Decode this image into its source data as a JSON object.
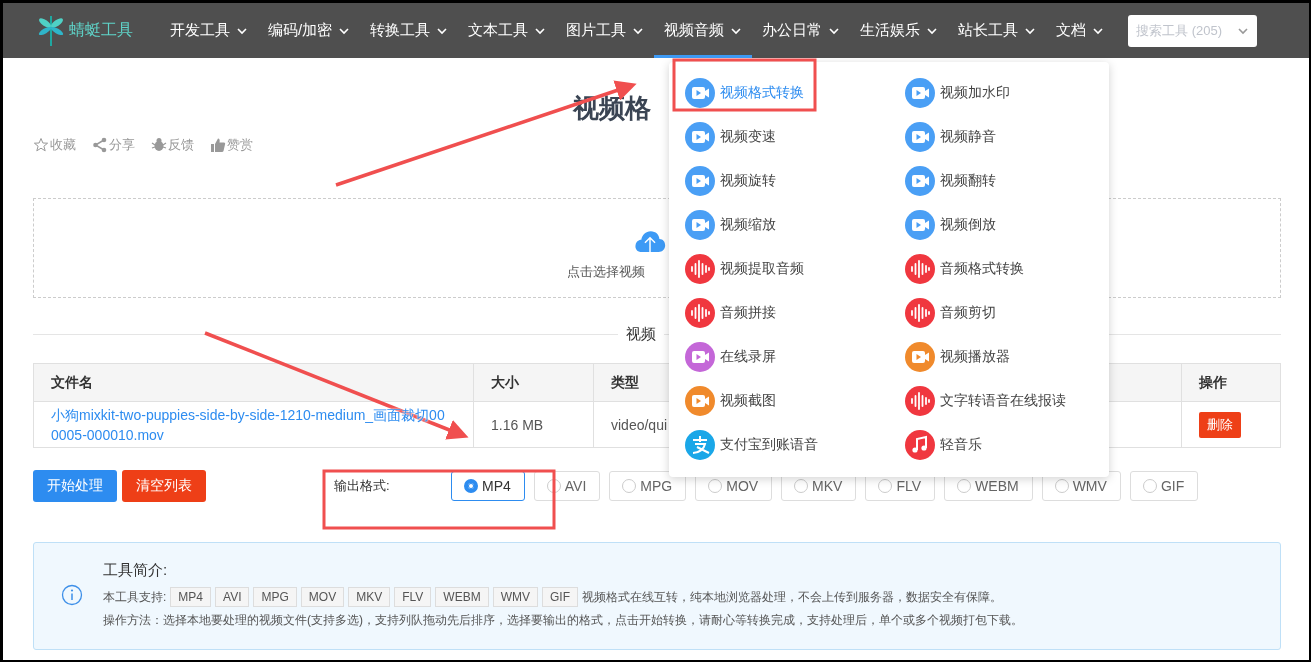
{
  "nav": {
    "logo": "蜻蜓工具",
    "items": [
      {
        "label": "开发工具",
        "selected": false
      },
      {
        "label": "编码/加密",
        "selected": false
      },
      {
        "label": "转换工具",
        "selected": false
      },
      {
        "label": "文本工具",
        "selected": false
      },
      {
        "label": "图片工具",
        "selected": false
      },
      {
        "label": "视频音频",
        "selected": true
      },
      {
        "label": "办公日常",
        "selected": false
      },
      {
        "label": "生活娱乐",
        "selected": false
      },
      {
        "label": "站长工具",
        "selected": false
      },
      {
        "label": "文档",
        "selected": false
      }
    ],
    "search": {
      "placeholder": "搜索工具 (205)"
    }
  },
  "dropdown": [
    {
      "label": "视频格式转换",
      "kind": "video",
      "selected": true
    },
    {
      "label": "视频加水印",
      "kind": "video",
      "selected": false
    },
    {
      "label": "视频变速",
      "kind": "video",
      "selected": false
    },
    {
      "label": "视频静音",
      "kind": "video",
      "selected": false
    },
    {
      "label": "视频旋转",
      "kind": "video",
      "selected": false
    },
    {
      "label": "视频翻转",
      "kind": "video",
      "selected": false
    },
    {
      "label": "视频缩放",
      "kind": "video",
      "selected": false
    },
    {
      "label": "视频倒放",
      "kind": "video",
      "selected": false
    },
    {
      "label": "视频提取音频",
      "kind": "audio",
      "selected": false
    },
    {
      "label": "音频格式转换",
      "kind": "audio",
      "selected": false
    },
    {
      "label": "音频拼接",
      "kind": "audio",
      "selected": false
    },
    {
      "label": "音频剪切",
      "kind": "audio",
      "selected": false
    },
    {
      "label": "在线录屏",
      "kind": "record",
      "selected": false
    },
    {
      "label": "视频播放器",
      "kind": "player",
      "selected": false
    },
    {
      "label": "视频截图",
      "kind": "player",
      "selected": false
    },
    {
      "label": "文字转语音在线报读",
      "kind": "audio",
      "selected": false
    },
    {
      "label": "支付宝到账语音",
      "kind": "alipay",
      "selected": false
    },
    {
      "label": "轻音乐",
      "kind": "music",
      "selected": false
    }
  ],
  "page": {
    "title": "视频格",
    "actions": [
      {
        "label": "收藏",
        "kind": "star"
      },
      {
        "label": "分享",
        "kind": "share"
      },
      {
        "label": "反馈",
        "kind": "bug"
      },
      {
        "label": "赞赏",
        "kind": "thumb"
      }
    ],
    "upload": {
      "hint": "点击选择视频"
    },
    "list_heading": "视频",
    "table": {
      "columns": [
        "文件名",
        "大小",
        "类型",
        "操作"
      ],
      "rows": [
        {
          "name": "小狗mixkit-two-puppies-side-by-side-1210-medium_画面裁切00 0005-000010.mov",
          "size": "1.16 MB",
          "type": "video/qui",
          "action": "删除"
        }
      ]
    },
    "buttons": [
      {
        "label": "开始处理",
        "kind": "primary"
      },
      {
        "label": "清空列表",
        "kind": "danger"
      }
    ],
    "output": {
      "label": "输出格式:",
      "options": [
        {
          "label": "MP4",
          "selected": true
        },
        {
          "label": "AVI",
          "selected": false
        },
        {
          "label": "MPG",
          "selected": false
        },
        {
          "label": "MOV",
          "selected": false
        },
        {
          "label": "MKV",
          "selected": false
        },
        {
          "label": "FLV",
          "selected": false
        },
        {
          "label": "WEBM",
          "selected": false
        },
        {
          "label": "WMV",
          "selected": false
        },
        {
          "label": "GIF",
          "selected": false
        }
      ]
    },
    "info": {
      "title": "工具简介:",
      "support_label": "本工具支持:",
      "tags": [
        "MP4",
        "AVI",
        "MPG",
        "MOV",
        "MKV",
        "FLV",
        "WEBM",
        "WMV",
        "GIF"
      ],
      "support_text": "视频格式在线互转，纯本地浏览器处理，不会上传到服务器，数据安全有保障。",
      "usage": "操作方法：选择本地要处理的视频文件(支持多选)，支持列队拖动先后排序，选择要输出的格式，点击开始转换，请耐心等转换完成，支持处理后，单个或多个视频打包下载。"
    }
  }
}
